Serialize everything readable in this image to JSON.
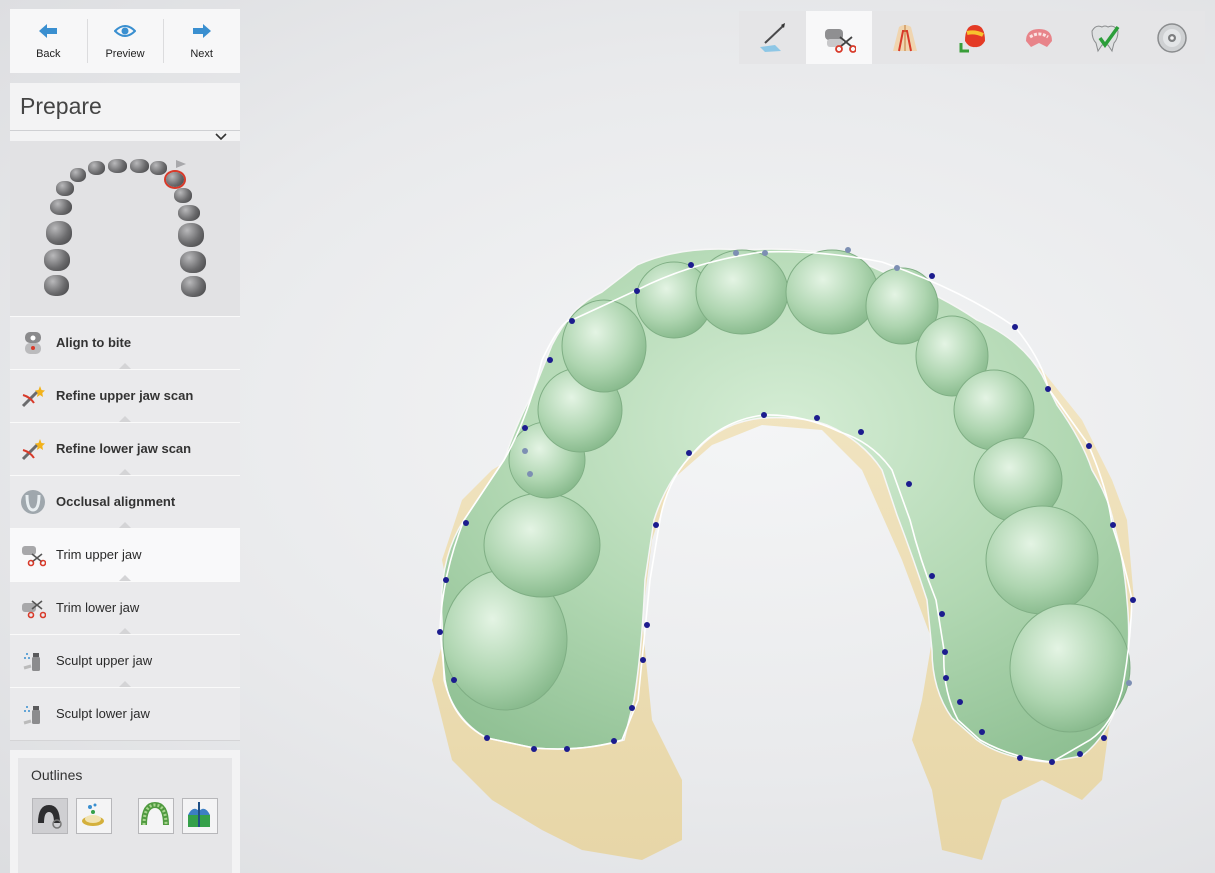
{
  "nav": {
    "back_label": "Back",
    "preview_label": "Preview",
    "next_label": "Next"
  },
  "prepare": {
    "title": "Prepare",
    "steps": [
      {
        "label": "Align to bite",
        "icon": "align-bite-icon",
        "state": "done"
      },
      {
        "label": "Refine upper jaw scan",
        "icon": "refine-wand-icon",
        "state": "done"
      },
      {
        "label": "Refine lower jaw scan",
        "icon": "refine-wand-icon",
        "state": "done"
      },
      {
        "label": "Occlusal alignment",
        "icon": "occlusal-icon",
        "state": "done"
      },
      {
        "label": "Trim upper jaw",
        "icon": "trim-scissors-icon",
        "state": "active"
      },
      {
        "label": "Trim lower jaw",
        "icon": "trim-scissors-icon",
        "state": "pending"
      },
      {
        "label": "Sculpt upper jaw",
        "icon": "sculpt-spray-icon",
        "state": "pending"
      },
      {
        "label": "Sculpt lower jaw",
        "icon": "sculpt-spray-icon",
        "state": "pending"
      }
    ]
  },
  "outlines": {
    "title": "Outlines",
    "buttons": [
      {
        "icon": "outline-upper-toggle-icon",
        "pressed": true
      },
      {
        "icon": "outline-model-icon",
        "pressed": false
      },
      {
        "icon": "outline-arch-icon",
        "pressed": false
      },
      {
        "icon": "outline-section-icon",
        "pressed": false
      }
    ]
  },
  "workflow": {
    "steps": [
      {
        "icon": "scan-knife-icon",
        "active": false
      },
      {
        "icon": "prepare-scissors-icon",
        "active": true
      },
      {
        "icon": "margin-tooth-icon",
        "active": false
      },
      {
        "icon": "insertion-direction-icon",
        "active": false
      },
      {
        "icon": "gingiva-icon",
        "active": false
      },
      {
        "icon": "finished-tooth-icon",
        "active": false
      },
      {
        "icon": "export-disc-icon",
        "active": false
      }
    ]
  },
  "colors": {
    "model_green": "#b8dbb8",
    "base_cream": "#efe1bb",
    "trim_point": "#1c1c8e",
    "accent_red": "#d83a2a"
  }
}
